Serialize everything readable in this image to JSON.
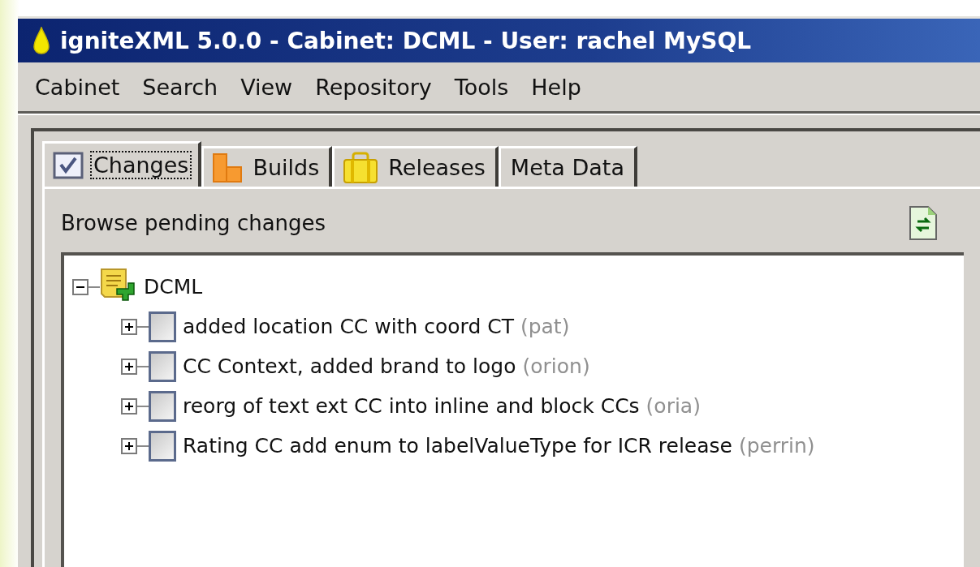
{
  "window": {
    "title": "igniteXML 5.0.0 - Cabinet: DCML - User: rachel MySQL"
  },
  "menu": [
    "Cabinet",
    "Search",
    "View",
    "Repository",
    "Tools",
    "Help"
  ],
  "tabs": [
    {
      "label": "Changes",
      "kind": "changes",
      "selected": true
    },
    {
      "label": "Builds",
      "kind": "builds",
      "selected": false
    },
    {
      "label": "Releases",
      "kind": "releases",
      "selected": false
    },
    {
      "label": "Meta Data",
      "kind": "plain",
      "selected": false
    }
  ],
  "panel": {
    "heading": "Browse pending changes"
  },
  "tree": {
    "label": "DCML",
    "expanded": true,
    "children": [
      {
        "label": "added location CC with coord CT",
        "author": "(pat)",
        "expanded": false,
        "checked": false
      },
      {
        "label": "CC Context, added brand to logo",
        "author": "(orion)",
        "expanded": false,
        "checked": false
      },
      {
        "label": "reorg of text ext CC into inline and block CCs",
        "author": "(oria)",
        "expanded": false,
        "checked": false
      },
      {
        "label": "Rating CC add enum to labelValueType for ICR release",
        "author": "(perrin)",
        "expanded": false,
        "checked": false
      }
    ]
  }
}
